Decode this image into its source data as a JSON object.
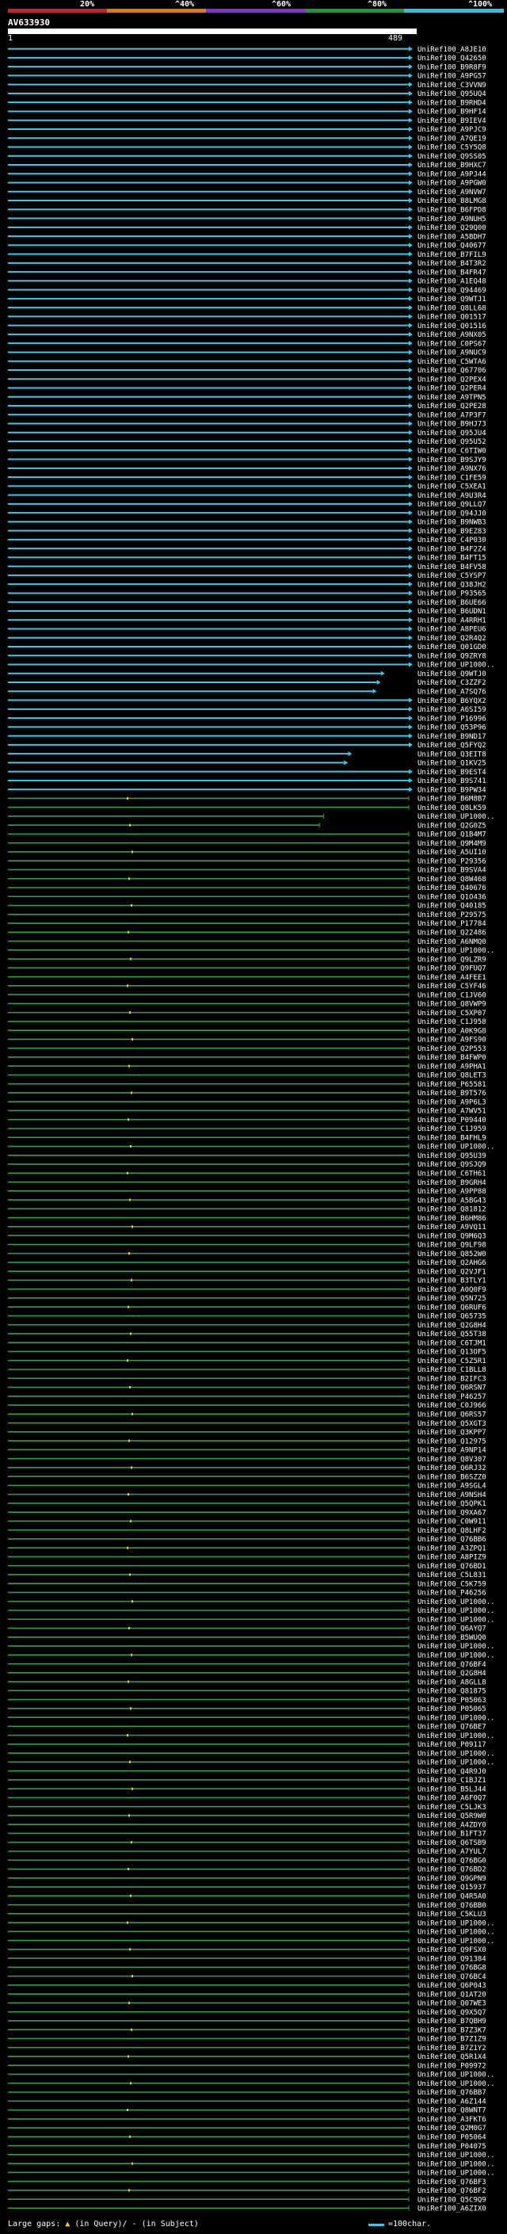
{
  "query": {
    "title": "AV633930",
    "start": "1",
    "end": "489"
  },
  "scale": {
    "ticks": [
      "20%",
      "^40%",
      "^60%",
      "^80%",
      "^100%"
    ],
    "colors": [
      "#e8102b",
      "#e87a00",
      "#8a2be2",
      "#11a02a",
      "#1ec8e8"
    ]
  },
  "colors": {
    "high": "#3cc8e8",
    "mid": "#2fa04a",
    "gap": "#ffd000",
    "background": "#000000",
    "text": "#ffffff"
  },
  "legend": {
    "prefix": "Large gaps:",
    "in_query": "(in Query)/",
    "in_subject": "- (in Subject)",
    "scale_text": "=100char."
  },
  "hits": [
    "UniRef100_A8JE10",
    "UniRef100_Q42650",
    "UniRef100_B9R8F9",
    "UniRef100_A9PG57",
    "UniRef100_C3VVN9",
    "UniRef100_Q95UQ4",
    "UniRef100_B9RHD4",
    "UniRef100_B9HF14",
    "UniRef100_B9IEV4",
    "UniRef100_A9PJC9",
    "UniRef100_A7QE19",
    "UniRef100_C5Y5Q8",
    "UniRef100_Q9SS05",
    "UniRef100_B9HXC7",
    "UniRef100_A9PJ44",
    "UniRef100_A9PGW0",
    "UniRef100_A9NVW7",
    "UniRef100_B8LMG8",
    "UniRef100_B6FPD8",
    "UniRef100_A9NUH5",
    "UniRef100_Q29Q00",
    "UniRef100_A5BDH7",
    "UniRef100_Q40677",
    "UniRef100_B7FIL9",
    "UniRef100_B4T3R2",
    "UniRef100_B4FR47",
    "UniRef100_A1EQ48",
    "UniRef100_Q94469",
    "UniRef100_Q9WTJ1",
    "UniRef100_Q8LL68",
    "UniRef100_Q01517",
    "UniRef100_Q01516",
    "UniRef100_A9NX05",
    "UniRef100_C0PS67",
    "UniRef100_A9NUC9",
    "UniRef100_C5WTA6",
    "UniRef100_Q67706",
    "UniRef100_Q2PEX4",
    "UniRef100_Q2PER4",
    "UniRef100_A9TPN5",
    "UniRef100_Q2PE28",
    "UniRef100_A7P3F7",
    "UniRef100_B9HJ73",
    "UniRef100_Q95JU4",
    "UniRef100_Q95U52",
    "UniRef100_C6TIW0",
    "UniRef100_B9SJY9",
    "UniRef100_A9NX76",
    "UniRef100_C1FE59",
    "UniRef100_C5XEA1",
    "UniRef100_A9U3R4",
    "UniRef100_Q9LLQ7",
    "UniRef100_Q94JJ0",
    "UniRef100_B9NWB3",
    "UniRef100_B9EZ83",
    "UniRef100_C4P030",
    "UniRef100_B4F2Z4",
    "UniRef100_B4FT15",
    "UniRef100_B4FV58",
    "UniRef100_C5YSP7",
    "UniRef100_Q38JH2",
    "UniRef100_P93565",
    "UniRef100_B6UE66",
    "UniRef100_B6UDN1",
    "UniRef100_A4RRH1",
    "UniRef100_A8PEU6",
    "UniRef100_Q2R4Q2",
    "UniRef100_Q01GD0",
    "UniRef100_Q9ZRY8",
    "UniRef100_UP1000..",
    "UniRef100_Q9WTJ0",
    "UniRef100_C3ZZF2",
    "UniRef100_A7SQ76",
    "UniRef100_B6YQX2",
    "UniRef100_A6SI59",
    "UniRef100_P16996",
    "UniRef100_Q53P96",
    "UniRef100_B9ND17",
    "UniRef100_Q5FYQ2",
    "UniRef100_Q3EIT8",
    "UniRef100_Q1KV25",
    "UniRef100_B9EST4",
    "UniRef100_B9S741",
    "UniRef100_B9PW34",
    "UniRef100_B6M8B7",
    "UniRef100_Q8LK59",
    "UniRef100_UP1000..",
    "UniRef100_Q2G0Z5",
    "UniRef100_Q1B4M7",
    "UniRef100_Q9M4M9",
    "UniRef100_A5UI10",
    "UniRef100_P29356",
    "UniRef100_B9SVA4",
    "UniRef100_Q8W468",
    "UniRef100_Q40676",
    "UniRef100_Q1O436",
    "UniRef100_Q40185",
    "UniRef100_P29575",
    "UniRef100_P17784",
    "UniRef100_Q22486",
    "UniRef100_A6NMQ0",
    "UniRef100_UP1000..",
    "UniRef100_Q9LZR9",
    "UniRef100_Q9FUQ7",
    "UniRef100_A4FEE1",
    "UniRef100_C5YF46",
    "UniRef100_C1JV60",
    "UniRef100_Q8VWP9",
    "UniRef100_C5XP07",
    "UniRef100_C1J958",
    "UniRef100_A0K9G8",
    "UniRef100_A9FS90",
    "UniRef100_Q2P553",
    "UniRef100_B4FWP0",
    "UniRef100_A9PHA1",
    "UniRef100_Q8LET3",
    "UniRef100_P65581",
    "UniRef100_B9T576",
    "UniRef100_A9P6L3",
    "UniRef100_A7WV51",
    "UniRef100_P09440",
    "UniRef100_C1J959",
    "UniRef100_B4FHL9",
    "UniRef100_UP1000..",
    "UniRef100_Q95U39",
    "UniRef100_Q9SJQ9",
    "UniRef100_C6TH61",
    "UniRef100_B9GRH4",
    "UniRef100_A9PP88",
    "UniRef100_A5BG43",
    "UniRef100_Q81812",
    "UniRef100_B6HM86",
    "UniRef100_A9VQ11",
    "UniRef100_Q9M6Q3",
    "UniRef100_Q9LF98",
    "UniRef100_Q852W0",
    "UniRef100_Q2AHG6",
    "UniRef100_Q2VJF1",
    "UniRef100_B3TLY1",
    "UniRef100_A0Q0F9",
    "UniRef100_Q5N725",
    "UniRef100_Q6RUF6",
    "UniRef100_Q65735",
    "UniRef100_Q2G8H4",
    "UniRef100_Q55T38",
    "UniRef100_C6TJM1",
    "UniRef100_Q13OF5",
    "UniRef100_C5Z5R1",
    "UniRef100_C1BLL8",
    "UniRef100_B2IFC3",
    "UniRef100_Q6RSN7",
    "UniRef100_P46257",
    "UniRef100_C0J966",
    "UniRef100_Q6RS57",
    "UniRef100_Q5XGT3",
    "UniRef100_Q3KPP7",
    "UniRef100_Q12975",
    "UniRef100_A9NP14",
    "UniRef100_Q8V307",
    "UniRef100_Q6RJ32",
    "UniRef100_B6SZZ0",
    "UniRef100_A9SGL4",
    "UniRef100_A9NSH4",
    "UniRef100_Q5QPK1",
    "UniRef100_Q9XA67",
    "UniRef100_C0W911",
    "UniRef100_Q8LHF2",
    "UniRef100_Q76BB6",
    "UniRef100_A3ZPQ1",
    "UniRef100_A8PIZ9",
    "UniRef100_Q76BD1",
    "UniRef100_C5L831",
    "UniRef100_C5K759",
    "UniRef100_P46256",
    "UniRef100_UP1000..",
    "UniRef100_UP1000..",
    "UniRef100_UP1000..",
    "UniRef100_Q6AYQ7",
    "UniRef100_B5WUQ0",
    "UniRef100_UP1000..",
    "UniRef100_UP1000..",
    "UniRef100_Q76BF4",
    "UniRef100_Q2G8H4",
    "UniRef100_A8GLL8",
    "UniRef100_Q81875",
    "UniRef100_P05063",
    "UniRef100_P05065",
    "UniRef100_UP1000..",
    "UniRef100_Q76BE7",
    "UniRef100_UP1000..",
    "UniRef100_P09117",
    "UniRef100_UP1000..",
    "UniRef100_UP1000..",
    "UniRef100_Q4R9J0",
    "UniRef100_C1BJZ1",
    "UniRef100_B5LJ44",
    "UniRef100_A6F0Q7",
    "UniRef100_C5LJK3",
    "UniRef100_Q5R9W0",
    "UniRef100_A4ZDY0",
    "UniRef100_B1FT37",
    "UniRef100_Q6TSB9",
    "UniRef100_A7YUL7",
    "UniRef100_Q76BG0",
    "UniRef100_Q76BD2",
    "UniRef100_Q9GPN9",
    "UniRef100_Q15937",
    "UniRef100_Q4R5A0",
    "UniRef100_Q76BB0",
    "UniRef100_C5KLU3",
    "UniRef100_UP1000..",
    "UniRef100_UP1000..",
    "UniRef100_UP1000..",
    "UniRef100_Q9FSX0",
    "UniRef100_Q91384",
    "UniRef100_Q76BG8",
    "UniRef100_Q76BC4",
    "UniRef100_Q6P043",
    "UniRef100_Q1AT20",
    "UniRef100_Q07WE3",
    "UniRef100_Q9X5Q7",
    "UniRef100_B7QBH9",
    "UniRef100_B7Z3K7",
    "UniRef100_B7Z1Z9",
    "UniRef100_B7Z1Y2",
    "UniRef100_Q5R1X4",
    "UniRef100_P09972",
    "UniRef100_UP1000..",
    "UniRef100_UP1000..",
    "UniRef100_Q76BB7",
    "UniRef100_A6Z144",
    "UniRef100_Q8WNT7",
    "UniRef100_A3FKT6",
    "UniRef100_Q2M0G7",
    "UniRef100_P05064",
    "UniRef100_P04075",
    "UniRef100_UP1000..",
    "UniRef100_UP1000..",
    "UniRef100_UP1000..",
    "UniRef100_Q76BF3",
    "UniRef100_Q76BF2",
    "UniRef100_Q5C9Q9",
    "UniRef100_A6ZIX0"
  ],
  "hit_spans": [
    [
      0,
      489
    ],
    [
      0,
      489
    ],
    [
      0,
      489
    ],
    [
      0,
      489
    ],
    [
      0,
      489
    ],
    [
      0,
      489
    ],
    [
      0,
      489
    ],
    [
      0,
      489
    ],
    [
      0,
      489
    ],
    [
      0,
      489
    ],
    [
      0,
      489
    ],
    [
      0,
      489
    ],
    [
      0,
      489
    ],
    [
      0,
      489
    ],
    [
      0,
      489
    ],
    [
      0,
      489
    ],
    [
      0,
      489
    ],
    [
      0,
      489
    ],
    [
      0,
      489
    ],
    [
      0,
      489
    ],
    [
      0,
      489
    ],
    [
      0,
      489
    ],
    [
      0,
      489
    ],
    [
      0,
      489
    ],
    [
      0,
      489
    ],
    [
      0,
      489
    ],
    [
      0,
      489
    ],
    [
      0,
      489
    ],
    [
      0,
      489
    ],
    [
      0,
      489
    ],
    [
      0,
      489
    ],
    [
      0,
      489
    ],
    [
      0,
      489
    ],
    [
      0,
      489
    ],
    [
      0,
      489
    ],
    [
      0,
      489
    ],
    [
      0,
      489
    ],
    [
      0,
      489
    ],
    [
      0,
      489
    ],
    [
      0,
      489
    ],
    [
      0,
      489
    ],
    [
      0,
      489
    ],
    [
      0,
      489
    ],
    [
      0,
      489
    ],
    [
      0,
      489
    ],
    [
      0,
      489
    ],
    [
      0,
      489
    ],
    [
      0,
      489
    ],
    [
      0,
      489
    ],
    [
      0,
      489
    ],
    [
      0,
      489
    ],
    [
      0,
      489
    ],
    [
      0,
      489
    ],
    [
      0,
      489
    ],
    [
      0,
      489
    ],
    [
      0,
      489
    ],
    [
      0,
      489
    ],
    [
      0,
      489
    ],
    [
      0,
      489
    ],
    [
      0,
      489
    ],
    [
      0,
      489
    ],
    [
      0,
      489
    ],
    [
      0,
      489
    ],
    [
      0,
      489
    ],
    [
      0,
      489
    ],
    [
      0,
      489
    ],
    [
      0,
      489
    ],
    [
      0,
      489
    ],
    [
      0,
      489
    ],
    [
      0,
      489
    ],
    [
      0,
      455
    ],
    [
      0,
      450
    ],
    [
      0,
      445
    ],
    [
      0,
      489
    ],
    [
      0,
      489
    ],
    [
      0,
      489
    ],
    [
      0,
      489
    ],
    [
      0,
      489
    ],
    [
      0,
      489
    ],
    [
      0,
      415
    ],
    [
      0,
      410
    ],
    [
      0,
      489
    ],
    [
      0,
      489
    ],
    [
      0,
      489
    ],
    [
      0,
      489
    ],
    [
      0,
      489
    ],
    [
      0,
      385
    ],
    [
      0,
      380
    ],
    [
      0,
      489
    ],
    [
      0,
      489
    ]
  ]
}
